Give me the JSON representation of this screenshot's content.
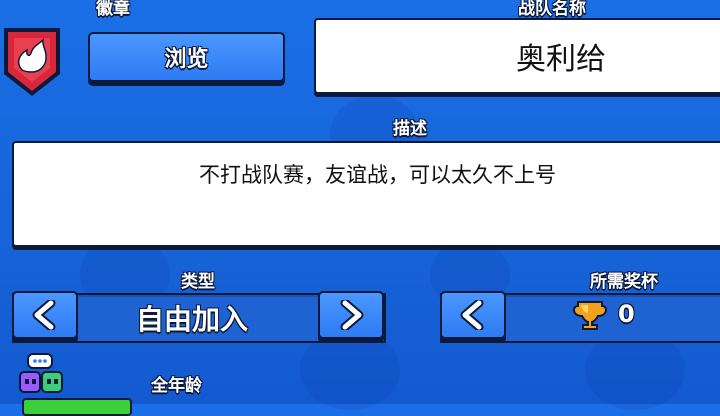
{
  "colors": {
    "background": "#1b6fe6",
    "button_blue": "#2e7bf3",
    "badge_red": "#d8263a",
    "outline": "#0b1a3a",
    "trophy": "#f4a21c",
    "toggle_green": "#3ccf3c"
  },
  "badge": {
    "label": "徽章",
    "browse_button": "浏览",
    "icon": "flame-badge-icon"
  },
  "club_name": {
    "label": "战队名称",
    "value": "奥利给"
  },
  "description": {
    "label": "描述",
    "value": "不打战队赛，友谊战，可以太久不上号"
  },
  "type": {
    "label": "类型",
    "value": "自由加入",
    "prev_icon": "chevron-left-icon",
    "next_icon": "chevron-right-icon"
  },
  "required_trophies": {
    "label": "所需奖杯",
    "value": "0",
    "icon": "trophy-icon"
  },
  "age": {
    "label": "全年龄",
    "icon": "chat-faces-icon"
  }
}
